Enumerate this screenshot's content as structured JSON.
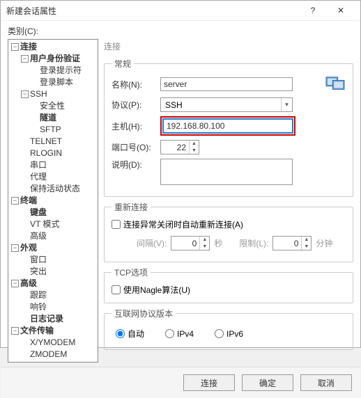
{
  "titlebar": {
    "title": "新建会话属性",
    "help": "?",
    "close": "✕"
  },
  "category_label": "类别(C):",
  "tree": {
    "connection": "连接",
    "auth": "用户身份验证",
    "login_prompt": "登录提示符",
    "login_script": "登录脚本",
    "ssh": "SSH",
    "security": "安全性",
    "tunnel": "隧道",
    "sftp": "SFTP",
    "telnet": "TELNET",
    "rlogin": "RLOGIN",
    "serial": "串口",
    "proxy": "代理",
    "keepalive": "保持活动状态",
    "terminal": "终端",
    "keyboard": "键盘",
    "vt": "VT 模式",
    "advanced1": "高级",
    "appearance": "外观",
    "window": "窗口",
    "highlight": "突出",
    "advanced2": "高级",
    "trace": "跟踪",
    "bell": "响铃",
    "log": "日志记录",
    "filetransfer": "文件传输",
    "xymodem": "X/YMODEM",
    "zmodem": "ZMODEM"
  },
  "right_title": "连接",
  "general": {
    "legend": "常规",
    "name_label": "名称(N):",
    "name_value": "server",
    "proto_label": "协议(P):",
    "proto_value": "SSH",
    "host_label": "主机(H):",
    "host_value": "192.168.80.100",
    "port_label": "端口号(O):",
    "port_value": "22",
    "desc_label": "说明(D):",
    "desc_value": ""
  },
  "reconnect": {
    "legend": "重新连接",
    "checkbox": "连接异常关闭时自动重新连接(A)",
    "interval_label": "间隔(V):",
    "interval_value": "0",
    "sec_label": "秒",
    "limit_label": "限制(L):",
    "limit_value": "0",
    "min_label": "分钟"
  },
  "tcp": {
    "legend": "TCP选项",
    "nagle": "使用Nagle算法(U)"
  },
  "ipver": {
    "legend": "互联网协议版本",
    "auto": "自动",
    "ipv4": "IPv4",
    "ipv6": "IPv6"
  },
  "footer": {
    "connect": "连接",
    "ok": "确定",
    "cancel": "取消"
  }
}
